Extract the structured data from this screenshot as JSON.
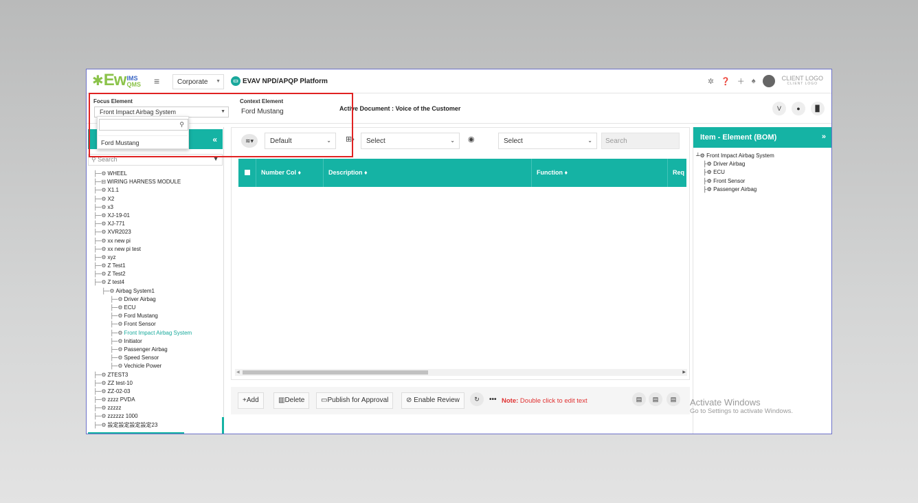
{
  "brand": {
    "logo_text": "Ew",
    "logo_sup": "IMS",
    "logo_sub": "QMS",
    "client_logo": "CLIENT LOGO",
    "client_logo_sub": "CLIENT LOGO"
  },
  "topbar": {
    "org": "Corporate",
    "platform": "EVAV NPD/APQP Platform",
    "icons": [
      "gear-icon",
      "help-icon",
      "plus-icon",
      "bell-icon",
      "avatar"
    ]
  },
  "context": {
    "focus_label": "Focus Element",
    "focus_value": "Front Impact Airbag System",
    "focus_options": [
      "Ford Mustang"
    ],
    "context_label": "Context Element",
    "context_value": "Ford Mustang",
    "active_doc": "Active Document : Voice of the Customer",
    "right_buttons": [
      "V",
      "●",
      "▉"
    ]
  },
  "left": {
    "search_placeholder": "Search",
    "tree": [
      {
        "label": "WHEEL",
        "indent": 0
      },
      {
        "label": "WIRING HARNESS MODULE",
        "indent": 0
      },
      {
        "label": "X1.1",
        "indent": 0
      },
      {
        "label": "X2",
        "indent": 0
      },
      {
        "label": "x3",
        "indent": 0
      },
      {
        "label": "XJ-19-01",
        "indent": 0
      },
      {
        "label": "XJ-771",
        "indent": 0
      },
      {
        "label": "XVR2023",
        "indent": 0
      },
      {
        "label": "xx new pi",
        "indent": 0
      },
      {
        "label": "xx new pi test",
        "indent": 0
      },
      {
        "label": "xyz",
        "indent": 0
      },
      {
        "label": "Z Test1",
        "indent": 0
      },
      {
        "label": "Z Test2",
        "indent": 0
      },
      {
        "label": "Z test4",
        "indent": 0
      },
      {
        "label": "Airbag System1",
        "indent": 1
      },
      {
        "label": "Driver Airbag",
        "indent": 2
      },
      {
        "label": "ECU",
        "indent": 2
      },
      {
        "label": "Ford Mustang",
        "indent": 2
      },
      {
        "label": "Front Sensor",
        "indent": 2
      },
      {
        "label": "Front Impact Airbag System",
        "indent": 2,
        "highlight": true
      },
      {
        "label": "Initiator",
        "indent": 2
      },
      {
        "label": "Passenger Airbag",
        "indent": 2
      },
      {
        "label": "Speed Sensor",
        "indent": 2
      },
      {
        "label": "Vechicle Power",
        "indent": 2
      },
      {
        "label": "ZTEST3",
        "indent": 0
      },
      {
        "label": "ZZ test-10",
        "indent": 0
      },
      {
        "label": "ZZ-02-03",
        "indent": 0
      },
      {
        "label": "zzzz PVDA",
        "indent": 0
      },
      {
        "label": "zzzzz",
        "indent": 0
      },
      {
        "label": "zzzzzz 1000",
        "indent": 0
      },
      {
        "label": "設定設定設定設定23",
        "indent": 0
      }
    ]
  },
  "center": {
    "view_select": "Default",
    "select1": "Select",
    "select2": "Select",
    "search_placeholder": "Search",
    "columns": [
      "Number Col ♦",
      "Description ♦",
      "Function ♦",
      "Req"
    ]
  },
  "actions": {
    "add": "+Add",
    "delete": "Delete",
    "publish": "Publish for Approval",
    "review": "Enable Review",
    "note_label": "Note:",
    "note_text": "Double click to edit text"
  },
  "right": {
    "title": "Item - Element (BOM)",
    "tree": [
      {
        "label": "Front Impact Airbag System",
        "indent": 0
      },
      {
        "label": "Driver Airbag",
        "indent": 1
      },
      {
        "label": "ECU",
        "indent": 1
      },
      {
        "label": "Front Sensor",
        "indent": 1
      },
      {
        "label": "Passenger Airbag",
        "indent": 1
      }
    ]
  },
  "watermark": {
    "title": "Activate Windows",
    "sub": "Go to Settings to activate Windows."
  }
}
